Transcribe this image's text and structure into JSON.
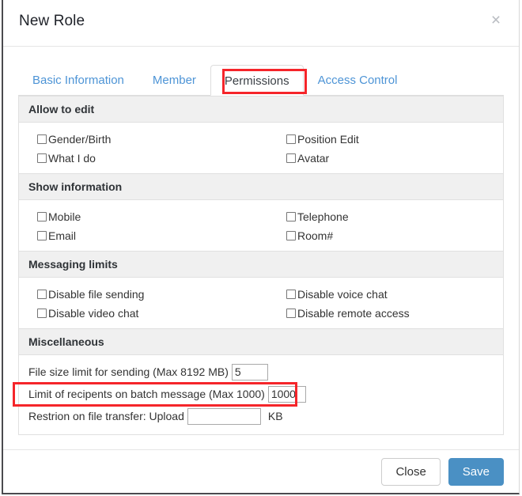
{
  "dialog": {
    "title": "New Role",
    "close_icon": "close-icon",
    "close_label": "×"
  },
  "tabs": [
    {
      "label": "Basic Information",
      "active": false
    },
    {
      "label": "Member",
      "active": false
    },
    {
      "label": "Permissions",
      "active": true
    },
    {
      "label": "Access Control",
      "active": false
    }
  ],
  "sections": [
    {
      "title": "Allow to edit",
      "checkboxes": [
        {
          "label": "Gender/Birth",
          "checked": false
        },
        {
          "label": "Position Edit",
          "checked": false
        },
        {
          "label": "What I do",
          "checked": false
        },
        {
          "label": "Avatar",
          "checked": false
        }
      ]
    },
    {
      "title": "Show information",
      "checkboxes": [
        {
          "label": "Mobile",
          "checked": false
        },
        {
          "label": "Telephone",
          "checked": false
        },
        {
          "label": "Email",
          "checked": false
        },
        {
          "label": "Room#",
          "checked": false
        }
      ]
    },
    {
      "title": "Messaging limits",
      "checkboxes": [
        {
          "label": "Disable file sending",
          "checked": false
        },
        {
          "label": "Disable voice chat",
          "checked": false
        },
        {
          "label": "Disable video chat",
          "checked": false
        },
        {
          "label": "Disable remote access",
          "checked": false
        }
      ]
    }
  ],
  "miscellaneous": {
    "title": "Miscellaneous",
    "file_size": {
      "label": "File size limit for sending (Max 8192 MB)",
      "value": "5",
      "placeholder": ""
    },
    "batch_limit": {
      "label": "Limit of recipents on batch message (Max 1000)",
      "value": "1000",
      "placeholder": ""
    },
    "file_transfer": {
      "label": "Restrion on file transfer: Upload",
      "value": "",
      "placeholder": "",
      "unit": "KB"
    }
  },
  "footer": {
    "close_label": "Close",
    "save_label": "Save"
  },
  "colors": {
    "tab_link": "#4d94d6",
    "tab_active_text": "#3b4046",
    "primary_button": "#4a90c4",
    "section_header_bg": "#f0f0f0",
    "annotation_red": "#f5252a"
  }
}
